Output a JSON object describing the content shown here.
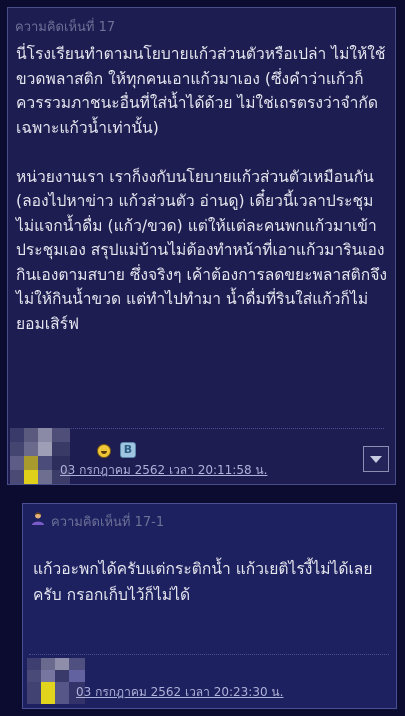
{
  "comment": {
    "header": "ความคิดเห็นที่ 17",
    "paragraph1": "นี่โรงเรียนทำตามนโยบายแก้วส่วนตัวหรือเปล่า ไม่ให้ใช้ขวดพลาสติก ให้ทุกคนเอาแก้วมาเอง (ซึ่งคำว่าแก้วก็ควรรวมภาชนะอื่นที่ใส่น้ำได้ด้วย ไม่ใช่เถรตรงว่าจำกัดเฉพาะแก้วน้ำเท่านั้น)",
    "paragraph2": "หน่วยงานเรา เราก็งงกับนโยบายแก้วส่วนตัวเหมือนกัน (ลองไปหาข่าว แก้วส่วนตัว อ่านดู) เดี๋ยวนี้เวลาประชุมไม่แจกน้ำดื่ม (แก้ว/ขวด) แต่ให้แต่ละคนพกแก้วมาเข้าประชุมเอง สรุปแม่บ้านไม่ต้องทำหน้าที่เอาแก้วมารินเองกินเองตามสบาย ซึ่งจริงๆ เค้าต้องการลดขยะพลาสติกจึงไม่ให้กินน้ำขวด แต่ทำไปทำมา น้ำดื่มที่รินใส่แก้วก็ไม่ยอมเสิร์ฟ",
    "date": "03 กรกฎาคม 2562 เวลา 20:11:58 น.",
    "emoji_icon": "laughing-face-icon",
    "badge_icon": "member-badge-icon",
    "badge_letter": "B",
    "menu_icon": "chevron-down-icon"
  },
  "reply": {
    "icon": "user-icon",
    "header": "ความคิดเห็นที่ 17-1",
    "body": "แก้วอะพกได้ครับแต่กระติกน้ำ แก้วเยติไรงี้ไม่ได้เลยครับ กรอกเก็บไว้ก็ไม่ได้",
    "date": "03 กรกฎาคม 2562 เวลา 20:23:30 น."
  },
  "colors": {
    "page_bg": "#0b0c30",
    "comment_bg": "#1d1d52",
    "reply_bg": "#1d2160",
    "text": "#e6e6ef",
    "muted": "#6d7196",
    "link": "#aeb2d8"
  }
}
